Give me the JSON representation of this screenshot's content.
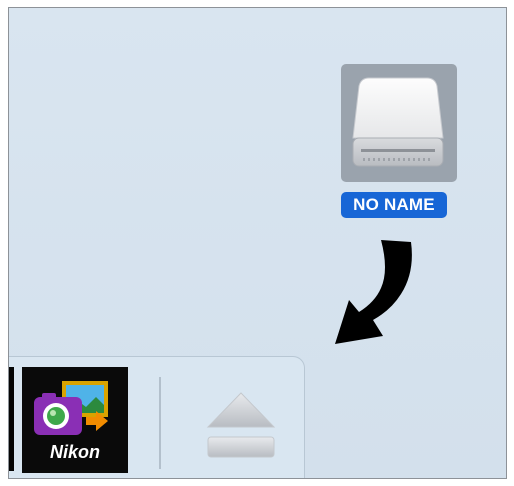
{
  "desktop": {
    "drive_label": "NO NAME",
    "drive_icon": "external-drive-icon",
    "arrow_icon": "curved-arrow-down-left-icon"
  },
  "dock": {
    "apps": [
      {
        "label": "Nikon",
        "icon": "nikon-transfer-app-icon"
      }
    ],
    "eject_icon": "eject-icon"
  },
  "colors": {
    "desktop_bg": "#d6e3ef",
    "selection": "#9aa3ad",
    "label_bg": "#1766d6",
    "arrow": "#000000"
  }
}
